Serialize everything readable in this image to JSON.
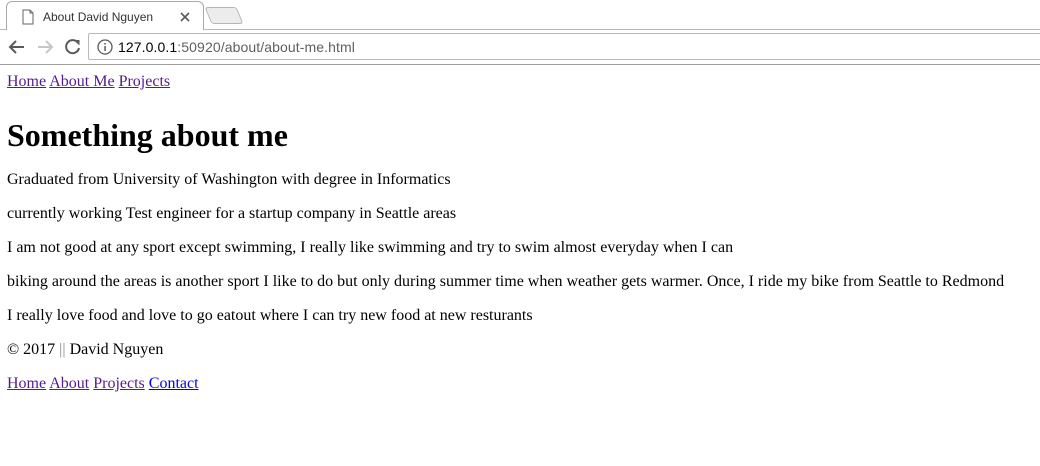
{
  "browser": {
    "tab_title": "About David Nguyen",
    "url_host": "127.0.0.1",
    "url_rest": ":50920/about/about-me.html"
  },
  "topnav": {
    "home": "Home",
    "about": "About Me",
    "projects": "Projects"
  },
  "heading": "Something about me",
  "paragraphs": [
    "Graduated from University of Washington with degree in Informatics",
    "currently working Test engineer for a startup company in Seattle areas",
    "I am not good at any sport except swimming, I really like swimming and try to swim almost everyday when I can",
    "biking around the areas is another sport I like to do but only during summer time when weather gets warmer. Once, I ride my bike from Seattle to Redmond",
    "I really love food and love to go eatout where I can try new food at new resturants"
  ],
  "footer": {
    "copyright": "© 2017",
    "separator": "||",
    "author": "David Nguyen"
  },
  "bottomnav": {
    "home": "Home",
    "about": "About",
    "projects": "Projects",
    "contact": "Contact"
  },
  "icons": {
    "tab": "page-icon",
    "close": "close-icon",
    "back": "back-arrow-icon",
    "forward": "forward-arrow-icon",
    "reload": "reload-icon",
    "info": "info-icon"
  },
  "colors": {
    "visited_link": "#551a8b",
    "unvisited_link": "#0000ee"
  }
}
